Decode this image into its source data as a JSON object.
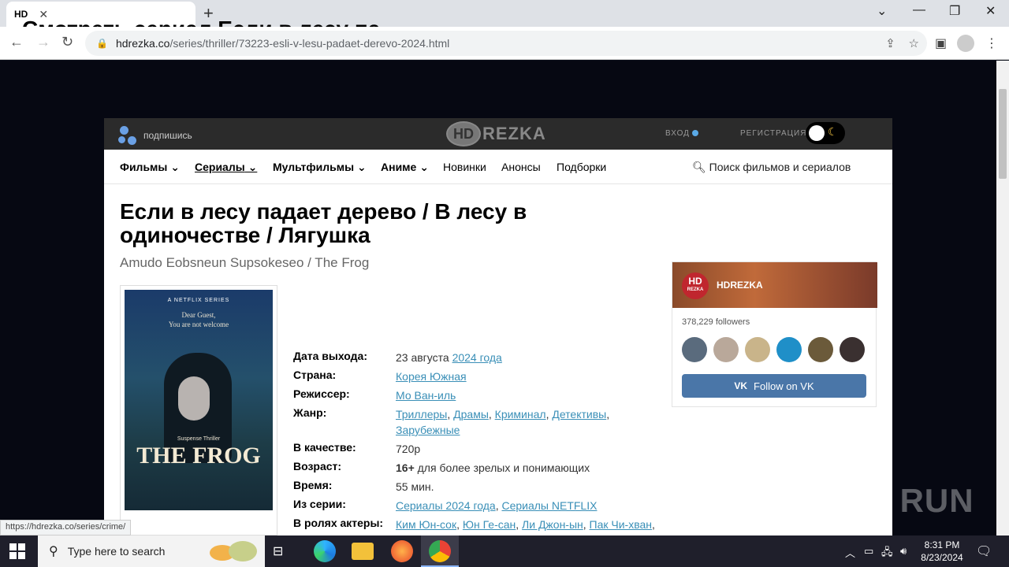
{
  "browser": {
    "tab_favicon": "HD",
    "tab_title": "Смотреть сериал Если в лесу па",
    "url_host": "hdrezka.co",
    "url_path": "/series/thriller/73223-esli-v-lesu-padaet-derevo-2024.html",
    "status_url": "https://hdrezka.co/series/crime/"
  },
  "site_header": {
    "subscribe": "подпишись",
    "logo_hd": "HD",
    "logo_text": "REZKA",
    "login": "ВХОД",
    "register": "РЕГИСТРАЦИЯ"
  },
  "nav": {
    "items": [
      "Фильмы",
      "Сериалы",
      "Мультфильмы",
      "Аниме",
      "Новинки",
      "Анонсы",
      "Подборки"
    ],
    "search": "Поиск фильмов и сериалов"
  },
  "movie": {
    "title": "Если в лесу падает дерево / В лесу в одиночестве / Лягушка",
    "original_title": "Amudo Eobsneun Supsokeseo / The Frog",
    "poster": {
      "series_label": "A NETFLIX SERIES",
      "tagline_1": "Dear Guest,",
      "tagline_2": "You are not welcome",
      "genre": "Suspense Thriller",
      "title": "THE FROG"
    },
    "info": {
      "release_label": "Дата выхода:",
      "release_day": "23 августа",
      "release_year": "2024 года",
      "country_label": "Страна:",
      "country": "Корея Южная",
      "director_label": "Режиссер:",
      "director": "Мо Ван-иль",
      "genre_label": "Жанр:",
      "genres": [
        "Триллеры",
        "Драмы",
        "Криминал",
        "Детективы",
        "Зарубежные"
      ],
      "quality_label": "В качестве:",
      "quality": "720p",
      "age_label": "Возраст:",
      "age": "16+",
      "age_desc": "для более зрелых и понимающих",
      "time_label": "Время:",
      "time": "55 мин.",
      "series_label": "Из серии:",
      "series": [
        "Сериалы 2024 года",
        "Сериалы NETFLIX"
      ],
      "cast_label": "В ролях актеры:",
      "cast": [
        "Ким Юн-сок",
        "Юн Ге-сан",
        "Ли Джон-ын",
        "Пак Чи-хван"
      ]
    }
  },
  "vk_widget": {
    "logo_top": "HD",
    "logo_bottom": "REZKA",
    "name": "HDREZKA",
    "followers": "378,229 followers",
    "button": "Follow on VK",
    "button_icon": "VK"
  },
  "watermark": "ANY RUN",
  "taskbar": {
    "search_placeholder": "Type here to search",
    "time": "8:31 PM",
    "date": "8/23/2024"
  }
}
